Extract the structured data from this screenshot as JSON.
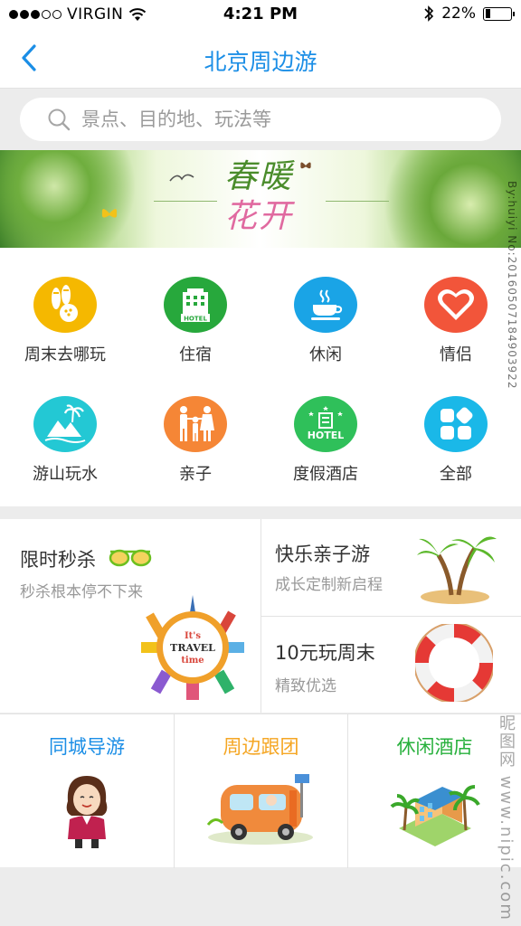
{
  "status_bar": {
    "carrier": "VIRGIN",
    "time": "4:21 PM",
    "battery": "22%",
    "battery_level": 0.22
  },
  "nav": {
    "title": "北京周边游"
  },
  "search": {
    "placeholder": "景点、目的地、玩法等"
  },
  "banner": {
    "title_line1": "春暖",
    "title_line2": "花开"
  },
  "categories": [
    {
      "label": "周末去哪玩",
      "icon": "bowling-icon",
      "color": "#f5b800"
    },
    {
      "label": "住宿",
      "icon": "hotel-icon",
      "color": "#27a83c"
    },
    {
      "label": "休闲",
      "icon": "coffee-cup-icon",
      "color": "#1aa4e6"
    },
    {
      "label": "情侣",
      "icon": "heart-icon",
      "color": "#f2553a"
    },
    {
      "label": "游山玩水",
      "icon": "island-icon",
      "color": "#23c8d4"
    },
    {
      "label": "亲子",
      "icon": "family-icon",
      "color": "#f58636"
    },
    {
      "label": "度假酒店",
      "icon": "resort-hotel-icon",
      "color": "#2fc05a"
    },
    {
      "label": "全部",
      "icon": "all-grid-icon",
      "color": "#1ab8e8"
    }
  ],
  "promo": {
    "flash_title": "限时秒杀",
    "flash_sub": "秒杀根本停不下来",
    "travel_badge": [
      "It's",
      "TRAVEL",
      "time"
    ],
    "family_title": "快乐亲子游",
    "family_sub": "成长定制新启程",
    "weekend_title": "10元玩周末",
    "weekend_sub": "精致优选"
  },
  "tours": [
    {
      "label": "同城导游",
      "color": "#1b8ee6"
    },
    {
      "label": "周边跟团",
      "color": "#f5a623"
    },
    {
      "label": "休闲酒店",
      "color": "#27b03c"
    }
  ],
  "watermarks": {
    "side": "By:huiyi No:20160507184903922",
    "site": "昵图网 www.nipic.com"
  }
}
